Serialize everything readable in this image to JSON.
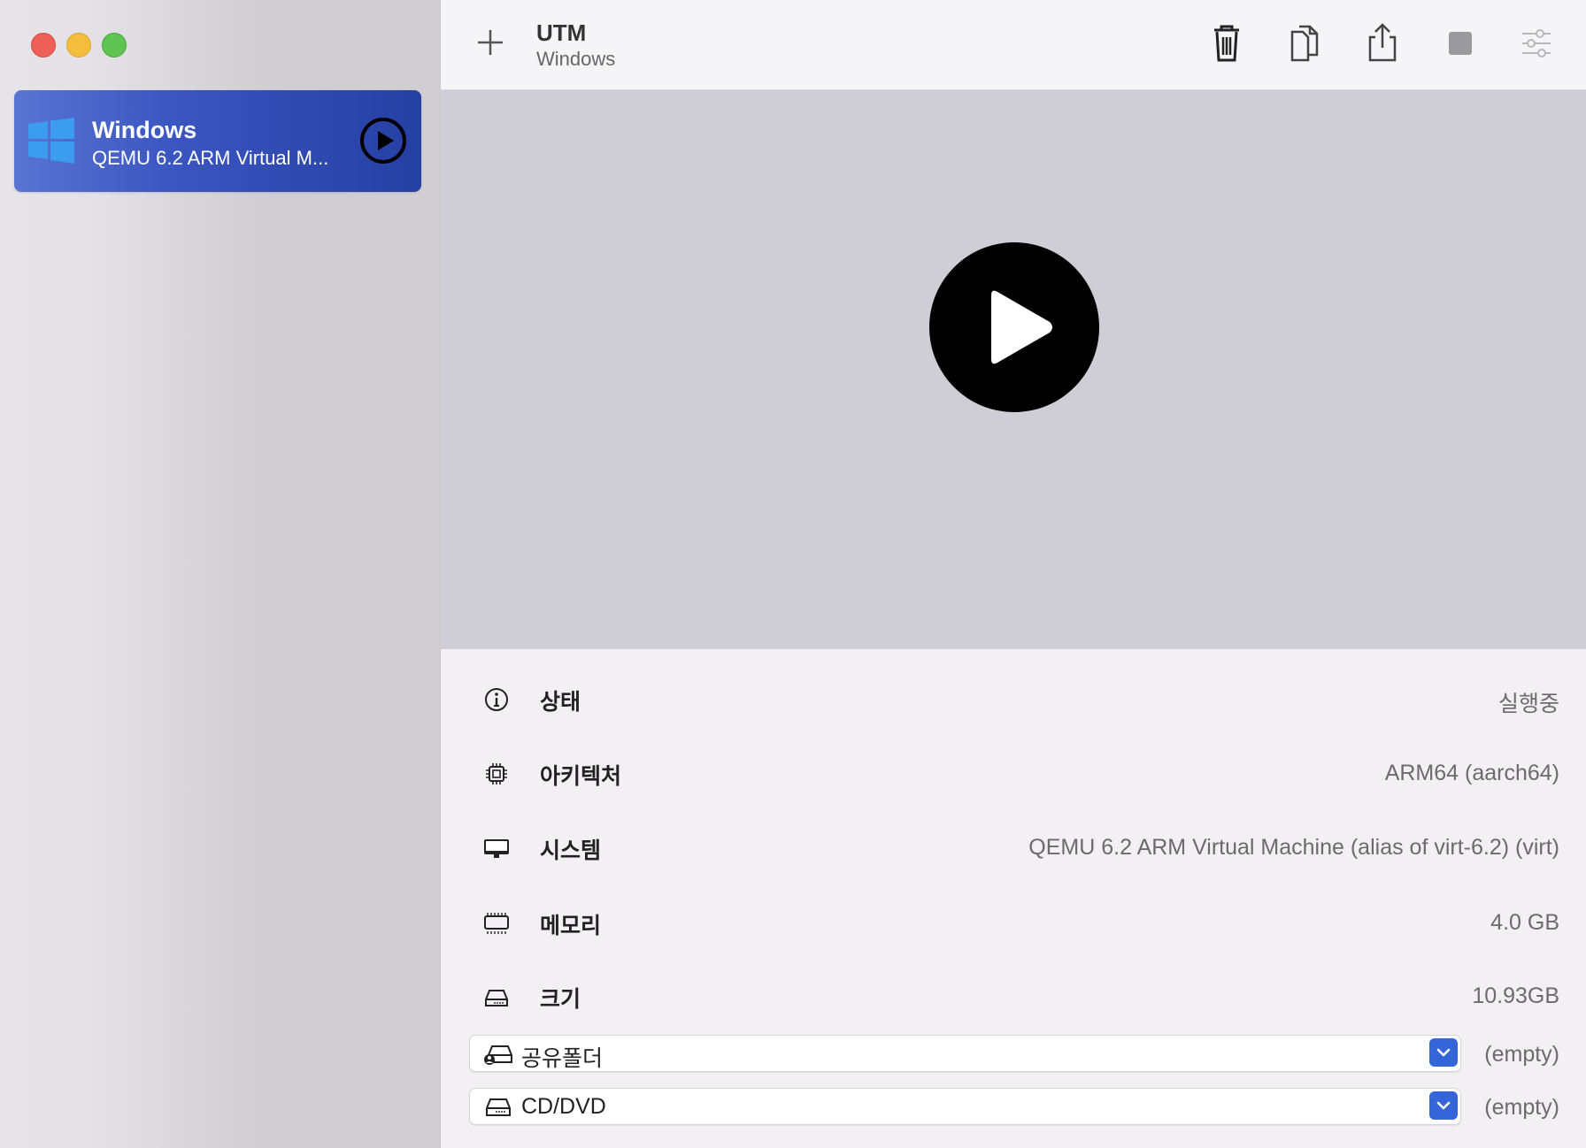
{
  "window": {
    "controls": [
      "close",
      "minimize",
      "maximize"
    ]
  },
  "sidebar": {
    "vm": {
      "name": "Windows",
      "subtitle": "QEMU 6.2 ARM Virtual M...",
      "icon": "windows-logo-icon"
    }
  },
  "toolbar": {
    "title": "UTM",
    "subtitle": "Windows",
    "icons": [
      "plus-icon",
      "trash-icon",
      "clone-icon",
      "share-icon",
      "stop-icon",
      "settings-sliders-icon"
    ]
  },
  "details": {
    "rows": [
      {
        "label": "상태",
        "value": "실행중",
        "icon": "info-icon"
      },
      {
        "label": "아키텍처",
        "value": "ARM64 (aarch64)",
        "icon": "cpu-icon"
      },
      {
        "label": "시스템",
        "value": "QEMU 6.2 ARM Virtual Machine (alias of virt-6.2) (virt)",
        "icon": "display-icon"
      },
      {
        "label": "메모리",
        "value": "4.0 GB",
        "icon": "memory-icon"
      },
      {
        "label": "크기",
        "value": "10.93GB",
        "icon": "disk-icon"
      }
    ],
    "selects": [
      {
        "label": "공유폴더",
        "value": "(empty)",
        "icon": "shared-drive-icon"
      },
      {
        "label": "CD/DVD",
        "value": "(empty)",
        "icon": "drive-icon"
      }
    ]
  },
  "colors": {
    "accent": "#3465d9",
    "selection": "#2f48b0",
    "preview_bg": "#cfcdd6"
  }
}
